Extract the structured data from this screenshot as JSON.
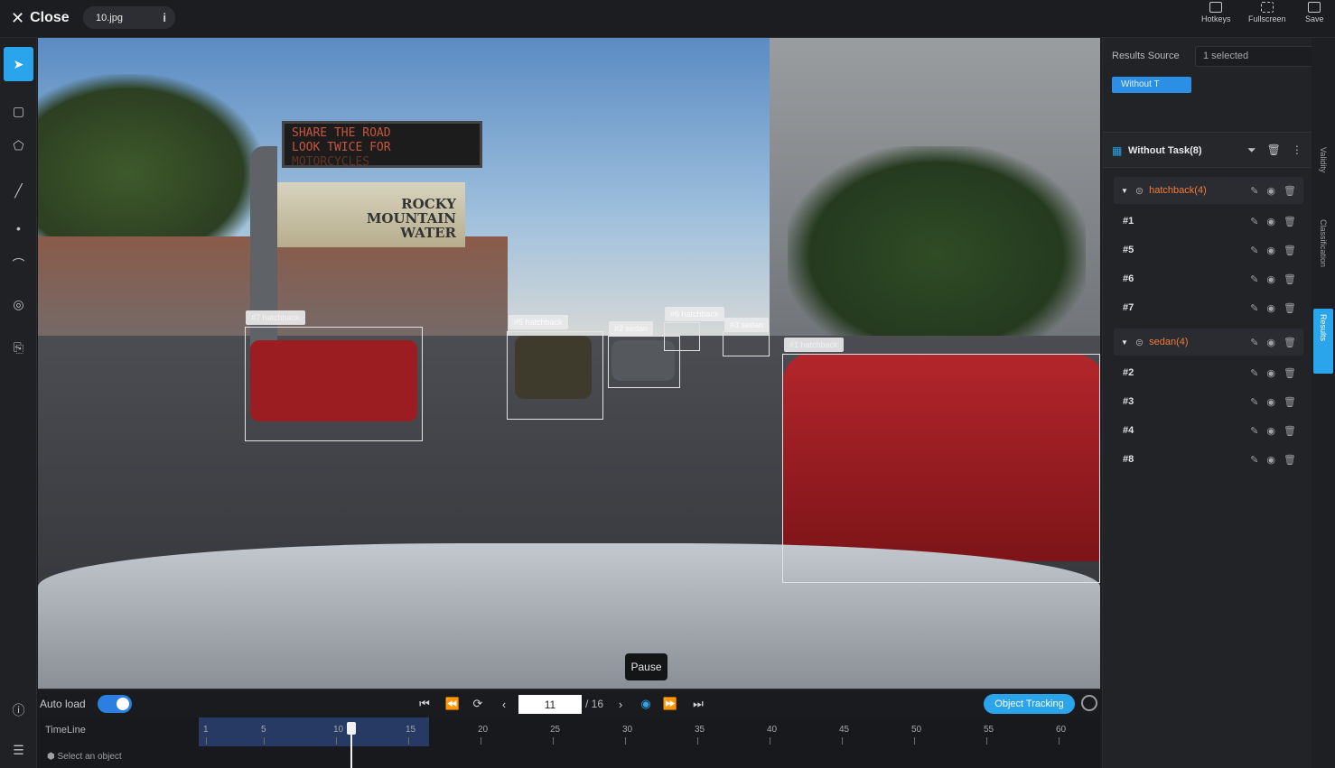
{
  "topbar": {
    "close_label": "Close",
    "file_name": "10.jpg",
    "info_glyph": "i",
    "hotkeys": "Hotkeys",
    "fullscreen": "Fullscreen",
    "save": "Save"
  },
  "tools": [
    {
      "name": "select",
      "icon": "cursor-icon",
      "active": true
    },
    {
      "name": "rect",
      "icon": "rectangle-tool-icon"
    },
    {
      "name": "polygon",
      "icon": "polygon-tool-icon"
    },
    {
      "name": "line",
      "icon": "line-tool-icon"
    },
    {
      "name": "point",
      "icon": "point-tool-icon"
    },
    {
      "name": "curve",
      "icon": "curve-tool-icon"
    },
    {
      "name": "cuboid",
      "icon": "target-tool-icon"
    },
    {
      "name": "ocr",
      "icon": "ocr-tool-icon"
    }
  ],
  "canvas": {
    "sign_text": [
      "SHARE THE ROAD",
      "LOOK TWICE FOR",
      "MOTORCYCLES"
    ],
    "billboard_text": [
      "ROCKY",
      "MOUNTAIN",
      "WATER"
    ],
    "tooltip": "Pause"
  },
  "controls": {
    "autoload_label": "Auto load",
    "autoload_on": true,
    "frame_value": "11",
    "frame_total": "/ 16",
    "object_tracking": "Object Tracking"
  },
  "timeline": {
    "label": "TimeLine",
    "select_object": "Select an object",
    "ticks": [
      "1",
      "5",
      "10",
      "15",
      "20",
      "25",
      "30",
      "35",
      "40",
      "45",
      "50",
      "55",
      "60"
    ],
    "current_frame": 11
  },
  "results": {
    "source_label": "Results Source",
    "source_select": "1 selected",
    "source_tag": "Without T",
    "task_title": "Without Task(8)",
    "groups": [
      {
        "label": "hatchback(4)",
        "items": [
          "#1",
          "#5",
          "#6",
          "#7"
        ]
      },
      {
        "label": "sedan(4)",
        "items": [
          "#2",
          "#3",
          "#4",
          "#8"
        ]
      }
    ]
  },
  "side_tabs": [
    "Validity",
    "Classification",
    "Results"
  ],
  "colors": {
    "accent": "#2aa4ea",
    "group_label": "#f07a3a",
    "toggle": "#2b7fe0"
  }
}
